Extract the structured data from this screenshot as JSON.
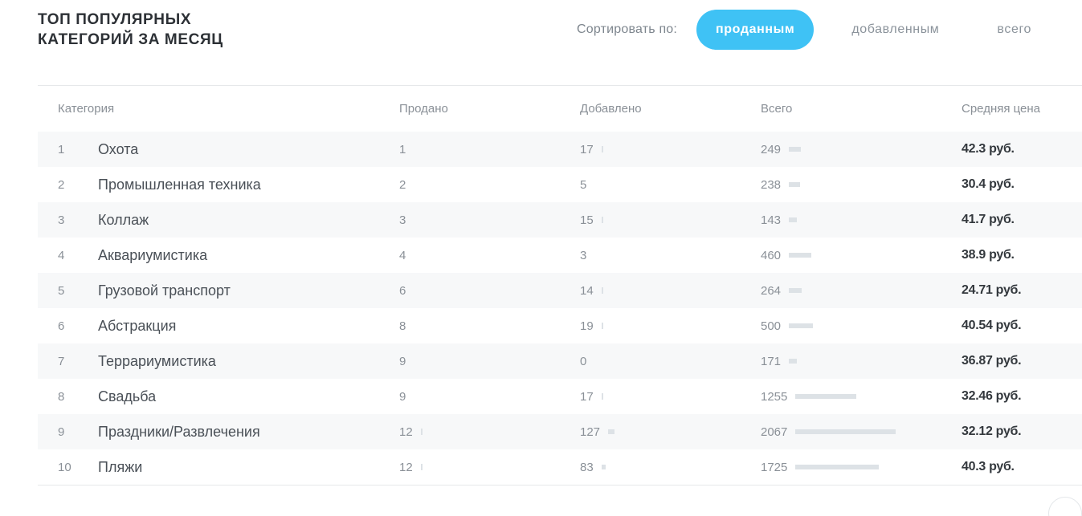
{
  "header": {
    "title_line1": "ТОП ПОПУЛЯРНЫХ",
    "title_line2": "КАТЕГОРИЙ ЗА МЕСЯЦ"
  },
  "sort": {
    "label": "Сортировать по:",
    "options": [
      "проданным",
      "добавленным",
      "всего"
    ],
    "active": "проданным",
    "active_color": "#3fc2f5"
  },
  "table": {
    "columns": [
      "Категория",
      "Продано",
      "Добавлено",
      "Всего",
      "Средняя цена"
    ],
    "rows": [
      {
        "num": "1",
        "name": "Охота",
        "sold": "1",
        "added": "17",
        "total": "249",
        "price": "42.3 руб."
      },
      {
        "num": "2",
        "name": "Промышленная техника",
        "sold": "2",
        "added": "5",
        "total": "238",
        "price": "30.4 руб."
      },
      {
        "num": "3",
        "name": "Коллаж",
        "sold": "3",
        "added": "15",
        "total": "143",
        "price": "41.7 руб."
      },
      {
        "num": "4",
        "name": "Аквариумистика",
        "sold": "4",
        "added": "3",
        "total": "460",
        "price": "38.9 руб."
      },
      {
        "num": "5",
        "name": "Грузовой транспорт",
        "sold": "6",
        "added": "14",
        "total": "264",
        "price": "24.71 руб."
      },
      {
        "num": "6",
        "name": "Абстракция",
        "sold": "8",
        "added": "19",
        "total": "500",
        "price": "40.54 руб."
      },
      {
        "num": "7",
        "name": "Террариумистика",
        "sold": "9",
        "added": "0",
        "total": "171",
        "price": "36.87 руб."
      },
      {
        "num": "8",
        "name": "Свадьба",
        "sold": "9",
        "added": "17",
        "total": "1255",
        "price": "32.46 руб."
      },
      {
        "num": "9",
        "name": "Праздники/Развлечения",
        "sold": "12",
        "added": "127",
        "total": "2067",
        "price": "32.12 руб."
      },
      {
        "num": "10",
        "name": "Пляжи",
        "sold": "12",
        "added": "83",
        "total": "1725",
        "price": "40.3 руб."
      }
    ]
  }
}
